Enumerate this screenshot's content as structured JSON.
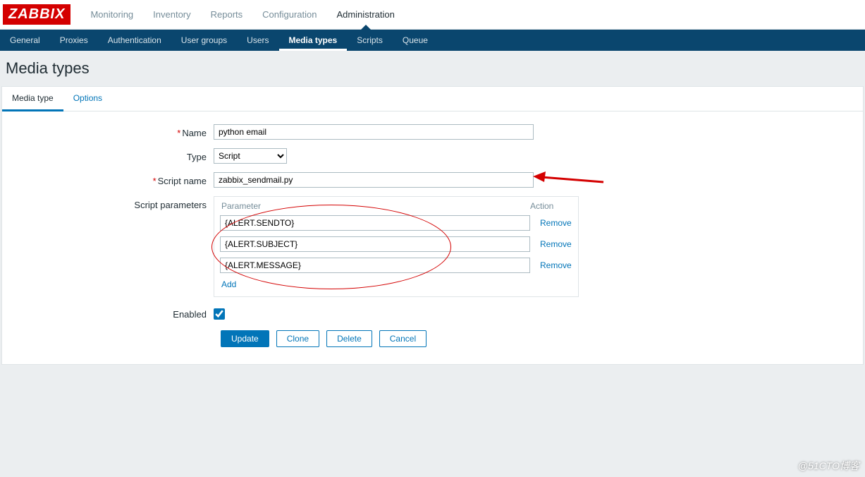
{
  "logo": "ZABBIX",
  "topnav": {
    "items": [
      {
        "label": "Monitoring"
      },
      {
        "label": "Inventory"
      },
      {
        "label": "Reports"
      },
      {
        "label": "Configuration"
      },
      {
        "label": "Administration",
        "active": true
      }
    ]
  },
  "subnav": {
    "items": [
      {
        "label": "General"
      },
      {
        "label": "Proxies"
      },
      {
        "label": "Authentication"
      },
      {
        "label": "User groups"
      },
      {
        "label": "Users"
      },
      {
        "label": "Media types",
        "active": true
      },
      {
        "label": "Scripts"
      },
      {
        "label": "Queue"
      }
    ]
  },
  "page": {
    "title": "Media types"
  },
  "tabs": {
    "items": [
      {
        "label": "Media type",
        "active": true
      },
      {
        "label": "Options"
      }
    ]
  },
  "form": {
    "name_label": "Name",
    "name_value": "python email",
    "type_label": "Type",
    "type_value": "Script",
    "script_label": "Script name",
    "script_value": "zabbix_sendmail.py",
    "params_label": "Script parameters",
    "params_header_param": "Parameter",
    "params_header_action": "Action",
    "params": [
      {
        "value": "{ALERT.SENDTO}",
        "remove": "Remove"
      },
      {
        "value": "{ALERT.SUBJECT}",
        "remove": "Remove"
      },
      {
        "value": "{ALERT.MESSAGE}",
        "remove": "Remove"
      }
    ],
    "add_label": "Add",
    "enabled_label": "Enabled",
    "enabled_checked": true
  },
  "buttons": {
    "update": "Update",
    "clone": "Clone",
    "delete": "Delete",
    "cancel": "Cancel"
  },
  "watermark": "@51CTO博客"
}
